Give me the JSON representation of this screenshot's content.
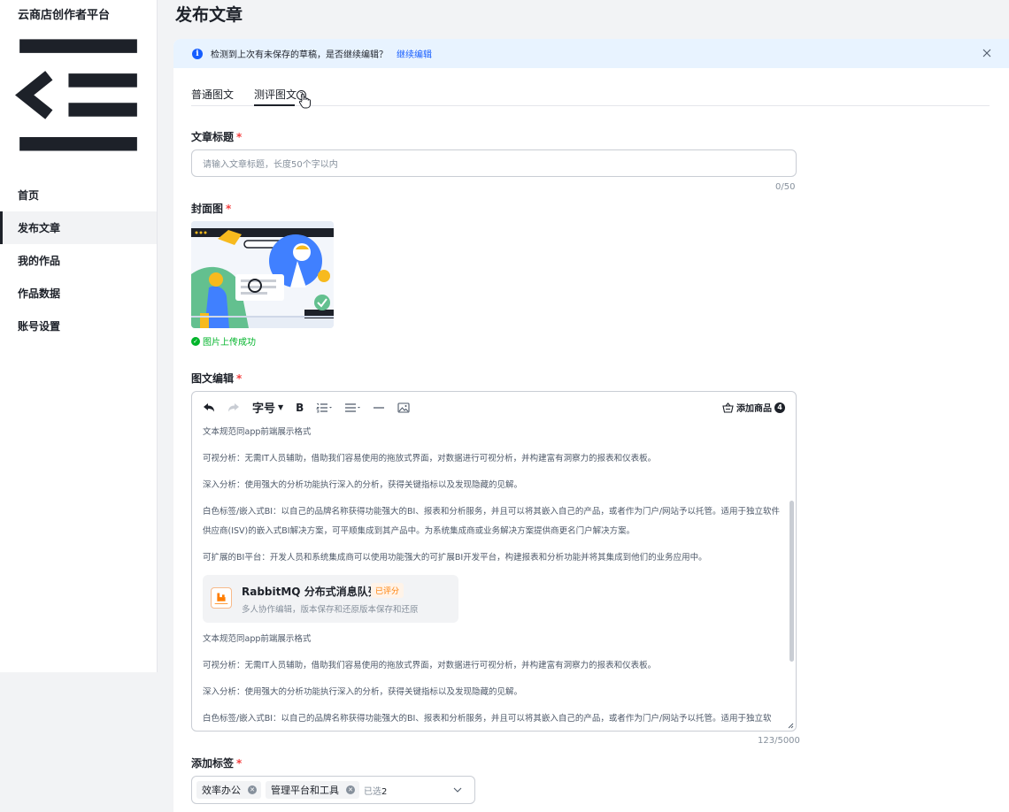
{
  "sidebar": {
    "brand": "云商店创作者平台",
    "items": [
      {
        "label": "首页"
      },
      {
        "label": "发布文章"
      },
      {
        "label": "我的作品"
      },
      {
        "label": "作品数据"
      },
      {
        "label": "账号设置"
      }
    ],
    "active_index": 1
  },
  "page": {
    "title": "发布文章"
  },
  "alert": {
    "text": "检测到上次有未保存的草稿，是否继续编辑？",
    "link": "继续编辑"
  },
  "tabs": [
    {
      "label": "普通图文"
    },
    {
      "label": "测评图文"
    }
  ],
  "form": {
    "title_label": "文章标题",
    "title_placeholder": "请输入文章标题，长度50个字以内",
    "title_counter": "0/50",
    "cover_label": "封面图",
    "cover_status": "图片上传成功",
    "content_label": "图文编辑",
    "content_counter": "123/5000",
    "tags_label": "添加标签",
    "required_mark": "*"
  },
  "editor": {
    "toolbar": {
      "font_size": "字号",
      "bold": "B",
      "add_product": "添加商品",
      "add_product_count": "4"
    },
    "paragraphs_1": [
      "文本规范同app前端展示格式",
      "可视分析：无需IT人员辅助，借助我们容易使用的拖放式界面，对数据进行可视分析，并构建富有洞察力的报表和仪表板。",
      "深入分析：使用强大的分析功能执行深入的分析，获得关键指标以及发现隐藏的见解。",
      "白色标签/嵌入式BI：以自己的品牌名称获得功能强大的BI、报表和分析服务，并且可以将其嵌入自己的产品，或者作为门户/网站予以托管。适用于独立软件供应商(ISV)的嵌入式BI解决方案，可平顺集成到其产品中。为系统集成商或业务解决方案提供商更名门户解决方案。",
      "可扩展的BI平台：开发人员和系统集成商可以使用功能强大的可扩展BI开发平台，构建报表和分析功能并将其集成到他们的业务应用中。"
    ],
    "product_card": {
      "name": "RabbitMQ 分布式消息队列",
      "badge": "已评分",
      "desc": "多人协作编辑，版本保存和还原版本保存和还原"
    },
    "paragraphs_2": [
      "文本规范同app前端展示格式",
      "可视分析：无需IT人员辅助，借助我们容易使用的拖放式界面，对数据进行可视分析，并构建富有洞察力的报表和仪表板。",
      "深入分析：使用强大的分析功能执行深入的分析，获得关键指标以及发现隐藏的见解。",
      "白色标签/嵌入式BI：以自己的品牌名称获得功能强大的BI、报表和分析服务，并且可以将其嵌入自己的产品，或者作为门户/网站予以托管。适用于独立软"
    ]
  },
  "tags": {
    "selected": [
      {
        "label": "效率办公"
      },
      {
        "label": "管理平台和工具"
      }
    ],
    "selected_prefix": "已选",
    "selected_count": "2"
  },
  "colors": {
    "accent": "#165dff",
    "required": "#f53f3f",
    "success": "#00b42a",
    "rated": "#ff7d00"
  }
}
